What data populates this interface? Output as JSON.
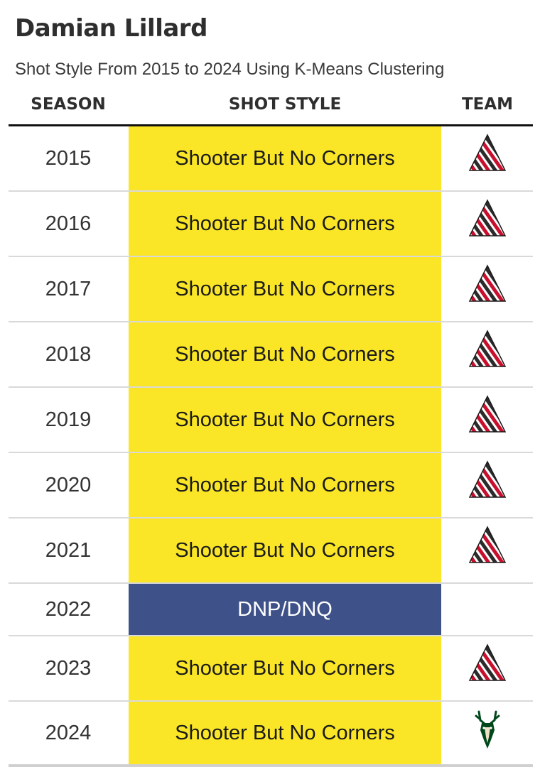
{
  "title": "Damian Lillard",
  "subtitle": "Shot Style From 2015 to 2024 Using K-Means Clustering",
  "columns": {
    "season": "SEASON",
    "shot_style": "SHOT STYLE",
    "team": "TEAM"
  },
  "colors": {
    "shooter_but_no_corners": "#fae626",
    "dnp_dnq": "#3e5289",
    "trail_blazers_red": "#c8102e",
    "bucks_green": "#00471b"
  },
  "rows": [
    {
      "season": "2015",
      "style": "Shooter But No Corners",
      "team_icon": "trail-blazers-logo-icon"
    },
    {
      "season": "2016",
      "style": "Shooter But No Corners",
      "team_icon": "trail-blazers-logo-icon"
    },
    {
      "season": "2017",
      "style": "Shooter But No Corners",
      "team_icon": "trail-blazers-logo-icon"
    },
    {
      "season": "2018",
      "style": "Shooter But No Corners",
      "team_icon": "trail-blazers-logo-icon"
    },
    {
      "season": "2019",
      "style": "Shooter But No Corners",
      "team_icon": "trail-blazers-logo-icon"
    },
    {
      "season": "2020",
      "style": "Shooter But No Corners",
      "team_icon": "trail-blazers-logo-icon"
    },
    {
      "season": "2021",
      "style": "Shooter But No Corners",
      "team_icon": "trail-blazers-logo-icon"
    },
    {
      "season": "2022",
      "style": "DNP/DNQ",
      "team_icon": ""
    },
    {
      "season": "2023",
      "style": "Shooter But No Corners",
      "team_icon": "trail-blazers-logo-icon"
    },
    {
      "season": "2024",
      "style": "Shooter But No Corners",
      "team_icon": "bucks-logo-icon"
    }
  ]
}
